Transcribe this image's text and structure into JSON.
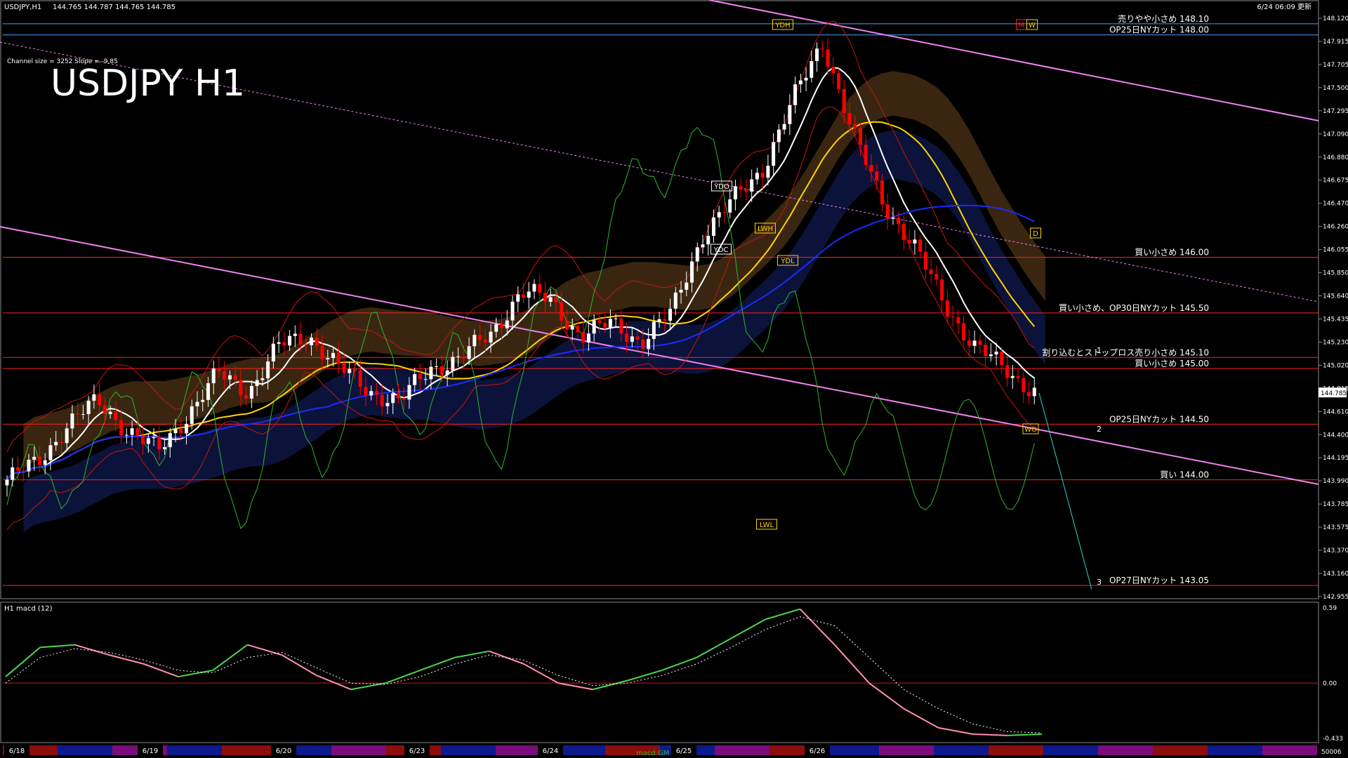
{
  "header": {
    "symbol_tf": "USDJPY,H1",
    "ohlc": "144.765 144.787 144.765 144.785",
    "updated": "6/24 06:09 更新",
    "channel_info": "Channel size = 3252 Slope = -9.85",
    "big_title": "USDJPY H1"
  },
  "colors": {
    "background": "#000000",
    "bull_candle": "#ffffff",
    "bear_candle": "#ff0000",
    "ma_white": "#ffffff",
    "ma_yellow": "#ffd400",
    "ma_blue": "#1a2bff",
    "chikou_green": "#2fb52f",
    "bollinger_red": "#c81414",
    "trend_channel": "#ee82ee",
    "level_line": "#ff2020",
    "cloud_orange": "#d08a3a",
    "cloud_blue": "#2a45d0",
    "macd_green": "#4cd64c",
    "macd_pink": "#ff8fb0"
  },
  "chart_data": [
    {
      "type": "candlestick",
      "title": "USDJPY H1",
      "ylim": [
        142.95,
        148.2
      ],
      "price_ticks": [
        "148.120",
        "147.915",
        "147.705",
        "147.500",
        "147.295",
        "147.090",
        "146.880",
        "146.675",
        "146.470",
        "146.260",
        "146.055",
        "145.850",
        "145.640",
        "145.435",
        "145.230",
        "145.020",
        "144.815",
        "144.610",
        "144.400",
        "144.195",
        "143.990",
        "143.785",
        "143.575",
        "143.370",
        "143.160",
        "142.955"
      ],
      "current_price": "144.785",
      "date_labels": [
        "6/18",
        "6/19",
        "6/20",
        "6/23",
        "6/24",
        "6/25",
        "6/26"
      ],
      "close_path": [
        144.0,
        144.15,
        144.5,
        144.7,
        144.45,
        144.25,
        144.6,
        144.95,
        144.8,
        145.2,
        145.3,
        145.0,
        144.8,
        144.7,
        145.0,
        145.1,
        145.3,
        145.7,
        145.6,
        145.3,
        145.4,
        145.25,
        145.5,
        146.2,
        146.5,
        146.8,
        147.4,
        147.95,
        147.1,
        146.5,
        146.1,
        145.6,
        145.2,
        145.0,
        144.8
      ],
      "levels": [
        {
          "label": "売りやや小さめ 148.10",
          "price": 148.1
        },
        {
          "label": "OP25日NYカット 148.00",
          "price": 148.0
        },
        {
          "label": "買い小さめ 146.00",
          "price": 146.0
        },
        {
          "label": "買い小さめ、OP30日NYカット 145.50",
          "price": 145.5
        },
        {
          "label": "割り込むとストップロス売り小さめ 145.10",
          "price": 145.1
        },
        {
          "label": "買い小さめ 145.00",
          "price": 145.0
        },
        {
          "label": "OP25日NYカット 144.50",
          "price": 144.5
        },
        {
          "label": "買い 144.00",
          "price": 144.0
        },
        {
          "label": "OP27日NYカット 143.05",
          "price": 143.05
        }
      ],
      "markers": [
        "YDH",
        "M",
        "W",
        "YDO",
        "LWH",
        "D",
        "YDC",
        "YDL",
        "LWL",
        "WO"
      ],
      "fib_labels": [
        "1",
        "2",
        "3"
      ]
    },
    {
      "type": "line",
      "title": "H1 macd (12)",
      "ylim": [
        -0.433,
        0.59
      ],
      "tick_labels": [
        "0.59",
        "0.00",
        "-0.433"
      ],
      "volume_label": "50006",
      "indicator_label": "macd GM",
      "macd": [
        0.05,
        0.28,
        0.3,
        0.22,
        0.15,
        0.05,
        0.1,
        0.3,
        0.22,
        0.06,
        -0.05,
        0.0,
        0.1,
        0.2,
        0.25,
        0.15,
        0.0,
        -0.05,
        0.02,
        0.1,
        0.2,
        0.35,
        0.5,
        0.58,
        0.3,
        0.0,
        -0.2,
        -0.35,
        -0.4,
        -0.41,
        -0.4
      ],
      "signal": [
        0.0,
        0.2,
        0.27,
        0.24,
        0.18,
        0.1,
        0.08,
        0.2,
        0.24,
        0.12,
        0.0,
        -0.01,
        0.05,
        0.15,
        0.22,
        0.18,
        0.06,
        -0.02,
        0.0,
        0.06,
        0.15,
        0.28,
        0.42,
        0.52,
        0.45,
        0.2,
        -0.05,
        -0.2,
        -0.32,
        -0.38,
        -0.39
      ]
    }
  ]
}
